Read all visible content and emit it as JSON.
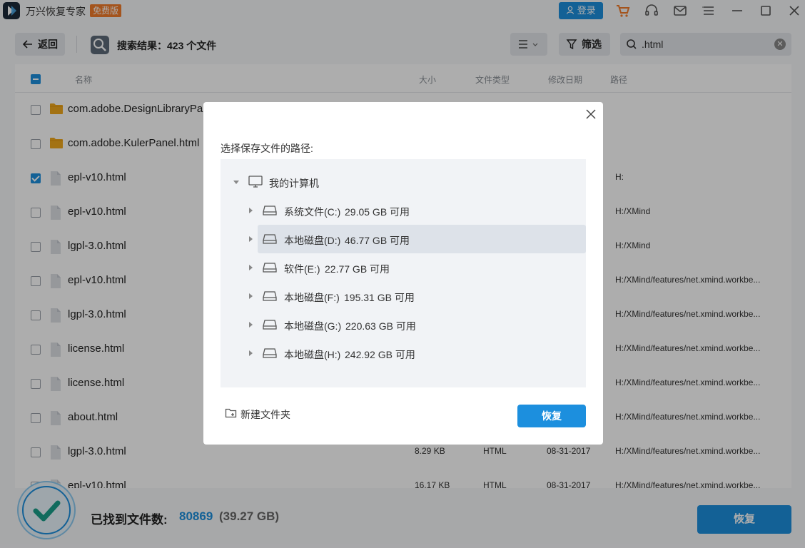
{
  "app": {
    "title": "万兴恢复专家",
    "badge": "免费版",
    "login_label": "登录",
    "icons": [
      "cart-icon",
      "headset-icon",
      "mail-icon",
      "menu-icon",
      "minimize-icon",
      "maximize-icon",
      "close-icon"
    ]
  },
  "toolbar": {
    "back_label": "返回",
    "search_result": "搜索结果：423 个文件",
    "filter_label": "筛选",
    "search_value": ".html"
  },
  "table": {
    "headers": {
      "name": "名称",
      "size": "大小",
      "type": "文件类型",
      "date": "修改日期",
      "path": "路径"
    },
    "rows": [
      {
        "name": "com.adobe.DesignLibraryPanel.html",
        "kind": "folder",
        "checked": false,
        "size": "",
        "type": "",
        "date": "",
        "path": ""
      },
      {
        "name": "com.adobe.KulerPanel.html",
        "kind": "folder",
        "checked": false,
        "size": "",
        "type": "",
        "date": "",
        "path": ""
      },
      {
        "name": "epl-v10.html",
        "kind": "file",
        "checked": true,
        "size": "",
        "type": "",
        "date": "",
        "path": "H:"
      },
      {
        "name": "epl-v10.html",
        "kind": "file",
        "checked": false,
        "size": "",
        "type": "",
        "date": "",
        "path": "H:/XMind"
      },
      {
        "name": "lgpl-3.0.html",
        "kind": "file",
        "checked": false,
        "size": "",
        "type": "",
        "date": "",
        "path": "H:/XMind"
      },
      {
        "name": "epl-v10.html",
        "kind": "file",
        "checked": false,
        "size": "",
        "type": "",
        "date": "",
        "path": "H:/XMind/features/net.xmind.workbe..."
      },
      {
        "name": "lgpl-3.0.html",
        "kind": "file",
        "checked": false,
        "size": "",
        "type": "",
        "date": "",
        "path": "H:/XMind/features/net.xmind.workbe..."
      },
      {
        "name": "license.html",
        "kind": "file",
        "checked": false,
        "size": "",
        "type": "",
        "date": "",
        "path": "H:/XMind/features/net.xmind.workbe..."
      },
      {
        "name": "license.html",
        "kind": "file",
        "checked": false,
        "size": "",
        "type": "",
        "date": "",
        "path": "H:/XMind/features/net.xmind.workbe..."
      },
      {
        "name": "about.html",
        "kind": "file",
        "checked": false,
        "size": "",
        "type": "",
        "date": "",
        "path": "H:/XMind/features/net.xmind.workbe..."
      },
      {
        "name": "lgpl-3.0.html",
        "kind": "file",
        "checked": false,
        "size": "8.29 KB",
        "type": "HTML",
        "date": "08-31-2017",
        "path": "H:/XMind/features/net.xmind.workbe..."
      },
      {
        "name": "epl-v10.html",
        "kind": "file",
        "checked": false,
        "size": "16.17 KB",
        "type": "HTML",
        "date": "08-31-2017",
        "path": "H:/XMind/features/net.xmind.workbe..."
      }
    ]
  },
  "bottom": {
    "found_label": "已找到文件数:",
    "found_count": "80869",
    "found_size": "(39.27 GB)",
    "recover_label": "恢复"
  },
  "dialog": {
    "title": "选择保存文件的路径:",
    "root_label": "我的计算机",
    "drives": [
      {
        "name": "系统文件(C:)",
        "free": "29.05 GB 可用",
        "selected": false
      },
      {
        "name": "本地磁盘(D:)",
        "free": "46.77 GB 可用",
        "selected": true
      },
      {
        "name": "软件(E:)",
        "free": "22.77 GB 可用",
        "selected": false
      },
      {
        "name": "本地磁盘(F:)",
        "free": "195.31 GB 可用",
        "selected": false
      },
      {
        "name": "本地磁盘(G:)",
        "free": "220.63 GB 可用",
        "selected": false
      },
      {
        "name": "本地磁盘(H:)",
        "free": "242.92 GB 可用",
        "selected": false
      }
    ],
    "new_folder_label": "新建文件夹",
    "recover_label": "恢复"
  },
  "colors": {
    "accent": "#1c8fde",
    "badge": "#f27c2c",
    "folder": "#f0a81c"
  }
}
